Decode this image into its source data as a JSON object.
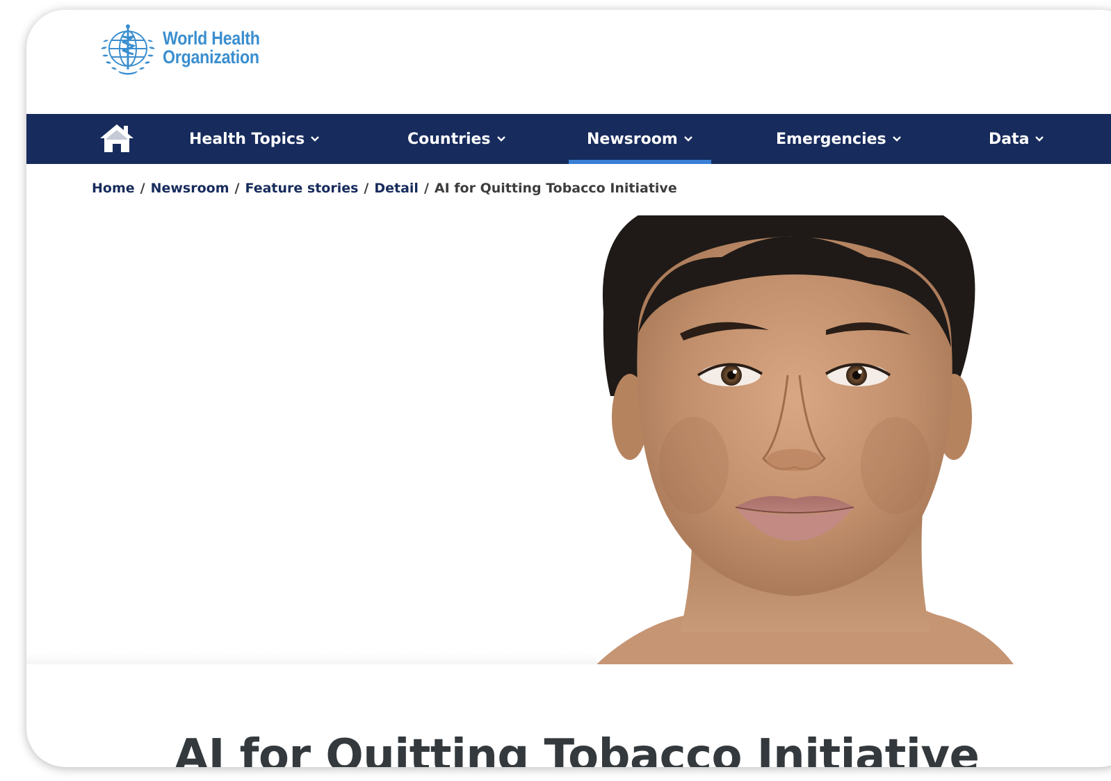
{
  "brand": {
    "line1": "World Health",
    "line2": "Organization"
  },
  "nav": {
    "home_icon": "home-icon",
    "items": [
      {
        "label": "Health Topics",
        "active": false
      },
      {
        "label": "Countries",
        "active": false
      },
      {
        "label": "Newsroom",
        "active": true
      },
      {
        "label": "Emergencies",
        "active": false
      },
      {
        "label": "Data",
        "active": false
      }
    ]
  },
  "breadcrumb": {
    "items": [
      "Home",
      "Newsroom",
      "Feature stories",
      "Detail"
    ],
    "current": "AI for Quitting Tobacco Initiative",
    "separator": "/"
  },
  "hero": {
    "icon": "digital-human-portrait"
  },
  "page": {
    "title": "AI for Quitting Tobacco Initiative"
  },
  "colors": {
    "nav_bg": "#172b5c",
    "brand_blue": "#3a8ecf",
    "active_underline": "#3a7fd6",
    "title": "#33393d"
  }
}
